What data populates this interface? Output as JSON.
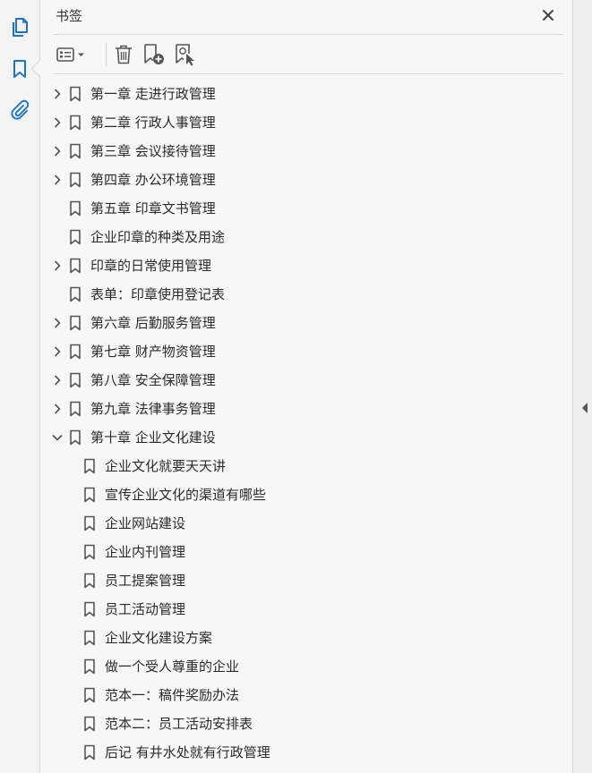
{
  "panel": {
    "title": "书签"
  },
  "rail": {
    "icons": [
      "pages-icon",
      "bookmark-icon",
      "attachment-icon"
    ],
    "accent": "#1a73c8"
  },
  "toolbar": {
    "icons": [
      "options-menu-icon",
      "delete-icon",
      "new-bookmark-icon",
      "bookmark-from-selection-icon"
    ]
  },
  "bookmarks": [
    {
      "label": "第一章  走进行政管理",
      "level": 0,
      "expander": "collapsed"
    },
    {
      "label": "第二章  行政人事管理",
      "level": 0,
      "expander": "collapsed"
    },
    {
      "label": "第三章  会议接待管理",
      "level": 0,
      "expander": "collapsed"
    },
    {
      "label": "第四章  办公环境管理",
      "level": 0,
      "expander": "collapsed"
    },
    {
      "label": "第五章  印章文书管理",
      "level": 0,
      "expander": "none"
    },
    {
      "label": "企业印章的种类及用途",
      "level": 0,
      "expander": "none"
    },
    {
      "label": "印章的日常使用管理",
      "level": 0,
      "expander": "collapsed"
    },
    {
      "label": "表单：印章使用登记表",
      "level": 0,
      "expander": "none"
    },
    {
      "label": "第六章  后勤服务管理",
      "level": 0,
      "expander": "collapsed"
    },
    {
      "label": "第七章  财产物资管理",
      "level": 0,
      "expander": "collapsed"
    },
    {
      "label": "第八章  安全保障管理",
      "level": 0,
      "expander": "collapsed"
    },
    {
      "label": "第九章  法律事务管理",
      "level": 0,
      "expander": "collapsed"
    },
    {
      "label": "第十章  企业文化建设",
      "level": 0,
      "expander": "expanded"
    },
    {
      "label": "企业文化就要天天讲",
      "level": 1,
      "expander": "none"
    },
    {
      "label": "宣传企业文化的渠道有哪些",
      "level": 1,
      "expander": "none"
    },
    {
      "label": "企业网站建设",
      "level": 1,
      "expander": "none"
    },
    {
      "label": "企业内刊管理",
      "level": 1,
      "expander": "none"
    },
    {
      "label": "员工提案管理",
      "level": 1,
      "expander": "none"
    },
    {
      "label": "员工活动管理",
      "level": 1,
      "expander": "none"
    },
    {
      "label": "企业文化建设方案",
      "level": 1,
      "expander": "none"
    },
    {
      "label": "做一个受人尊重的企业",
      "level": 1,
      "expander": "none"
    },
    {
      "label": "范本一：稿件奖励办法",
      "level": 1,
      "expander": "none"
    },
    {
      "label": "范本二：员工活动安排表",
      "level": 1,
      "expander": "none"
    },
    {
      "label": "后记  有井水处就有行政管理",
      "level": 1,
      "expander": "none"
    }
  ]
}
